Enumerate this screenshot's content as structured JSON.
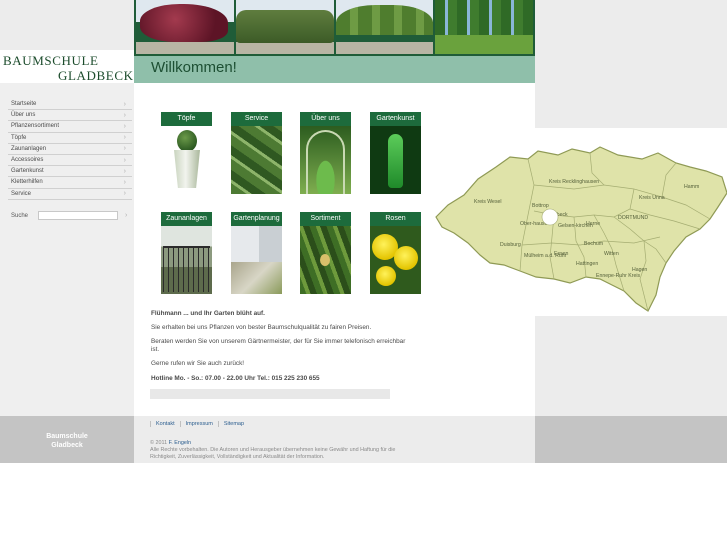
{
  "logo": {
    "line1": "BAUMSCHULE",
    "line2": "GLADBECK"
  },
  "header_photos": [
    "tree-photo-1",
    "hedge-photo",
    "avenue-photo",
    "tree-rows-photo"
  ],
  "welcome": {
    "title": "Willkommen!"
  },
  "sidebar": {
    "items": [
      {
        "label": "Startseite"
      },
      {
        "label": "Über uns"
      },
      {
        "label": "Pflanzensortiment"
      },
      {
        "label": "Töpfe"
      },
      {
        "label": "Zaunanlagen"
      },
      {
        "label": "Accessoires"
      },
      {
        "label": "Gartenkunst"
      },
      {
        "label": "Kletterhilfen"
      },
      {
        "label": "Service"
      }
    ],
    "search_label": "Suche"
  },
  "tiles": [
    {
      "label": "Töpfe"
    },
    {
      "label": "Service"
    },
    {
      "label": "Über uns"
    },
    {
      "label": "Gartenkunst"
    },
    {
      "label": "Zaunanlagen"
    },
    {
      "label": "Gartenplanung"
    },
    {
      "label": "Sortiment"
    },
    {
      "label": "Rosen"
    }
  ],
  "content": {
    "headline": "Flühmann ... und Ihr Garten blüht auf.",
    "p1": "Sie erhalten bei uns Pflanzen von bester Baumschulqualität zu fairen Preisen.",
    "p2": "Beraten werden Sie von unserem Gärtnermeister, der für Sie immer telefonisch erreichbar ist.",
    "p3": "Gerne rufen wir Sie auch zurück!",
    "hotline": "Hotline Mo. - So.: 07.00 - 22.00 Uhr Tel.: 015 225 230 655"
  },
  "map": {
    "labels": [
      "Kreis Recklinghausen",
      "Hamm",
      "Kreis Unna",
      "DORTMUND",
      "Kreis Wesel",
      "Bottrop",
      "Glad-beck",
      "Ober-hausen",
      "Gelsen-kirchen",
      "Herne",
      "Bochum",
      "Duisburg",
      "Essen",
      "Mülheim a.d. Ruhr",
      "Witten",
      "Hattingen",
      "Ennepe-Ruhr Kreis",
      "Hagen"
    ],
    "fill": "#dfe3a9",
    "stroke": "#8f9a55"
  },
  "footer": {
    "brand_line1": "Baumschule",
    "brand_line2": "Gladbeck",
    "links": [
      "Kontakt",
      "Impressum",
      "Sitemap"
    ],
    "copy_prefix": "© 2011",
    "copy_author": "F. Engeln",
    "copy_text": "Alle Rechte vorbehalten. Die Autoren und Herausgeber übernehmen keine Gewähr und Haftung für die Richtigkeit, Zuverlässigkeit, Vollständigkeit und Aktualität der Information."
  }
}
